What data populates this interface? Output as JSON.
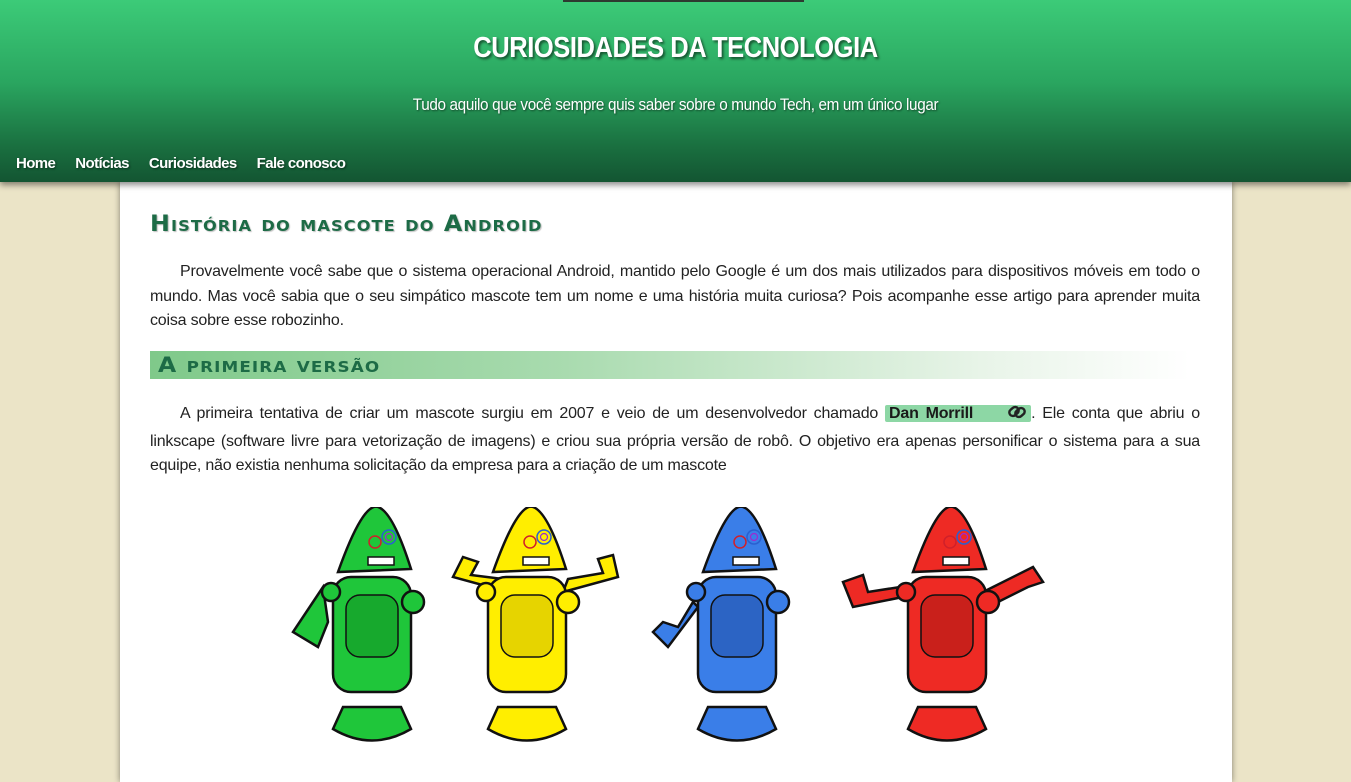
{
  "header": {
    "title": "CURIOSIDADES DA TECNOLOGIA",
    "subtitle": "Tudo aquilo que você sempre quis saber sobre o mundo Tech, em um único lugar"
  },
  "nav": {
    "items": [
      {
        "label": "Home"
      },
      {
        "label": "Notícias"
      },
      {
        "label": "Curiosidades"
      },
      {
        "label": "Fale conosco"
      }
    ]
  },
  "article": {
    "title": "História do mascote do Android",
    "intro": "Provavelmente você sabe que o sistema operacional Android, mantido pelo Google é um dos mais utilizados para dispositivos móveis em todo o mundo. Mas você sabia que o seu simpático mascote tem um nome e uma história muita curiosa? Pois acompanhe esse artigo para aprender muita coisa sobre esse robozinho.",
    "section_title": "A primeira versão",
    "first_para_before": "A primeira tentativa de criar um mascote surgiu em 2007 e veio de um desenvolvedor chamado ",
    "first_para_link": "Dan Morrill",
    "first_para_after": ". Ele conta que abriu o linkscape (software livre para vetorização de imagens) e criou sua própria versão de robô. O objetivo era apenas personificar o sistema para a sua equipe, não existia nenhuma solicitação da empresa para a criação de um mascote"
  },
  "colors": {
    "header_top": "#3ccb78",
    "header_bottom": "#135532",
    "page_bg": "#ebe4c7",
    "title_green": "#1d6b46",
    "link_bg": "#8dd7a5",
    "robot_colors": [
      "#1fc63a",
      "#ffee00",
      "#3a7ee8",
      "#ee2a24"
    ]
  },
  "icons": {
    "link": "link-icon"
  }
}
